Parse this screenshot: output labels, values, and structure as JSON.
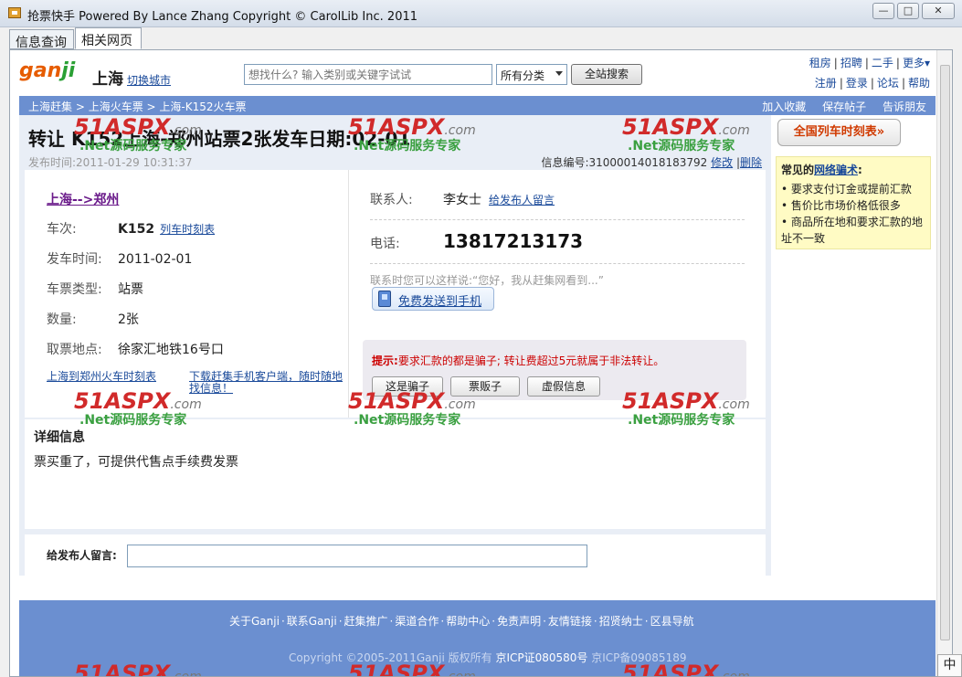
{
  "window": {
    "title": "抢票快手 Powered By Lance Zhang Copyright © CarolLib Inc. 2011",
    "minimize": "—",
    "maximize": "□",
    "close": "✕"
  },
  "tabs": [
    {
      "label": "信息查询"
    },
    {
      "label": "相关网页"
    }
  ],
  "header": {
    "logo_a": "gan",
    "logo_b": "ji",
    "city": "上海",
    "switch_city": "切换城市",
    "search_placeholder": "想找什么? 输入类别或关键字试试",
    "category": "所有分类",
    "search_button": "全站搜索",
    "links_top": [
      "租房",
      "招聘",
      "二手",
      "更多▾"
    ],
    "links_bottom": [
      "注册",
      "登录",
      "论坛",
      "帮助"
    ]
  },
  "breadcrumb": {
    "items": [
      "上海赶集",
      "> 上海火车票",
      "> 上海-K152火车票"
    ],
    "actions": [
      "加入收藏",
      "保存帖子",
      "告诉朋友"
    ]
  },
  "post": {
    "title": "转让 K152上海-郑州站票2张发车日期:02-01",
    "posted": "发布时间:2011-01-29 10:31:37",
    "info_no_label": "信息编号:",
    "info_no": "31000014018183792",
    "edit": "修改",
    "delete": "删除",
    "route": "上海-->郑州",
    "fields": [
      {
        "k": "车次:",
        "v": "K152",
        "link": "列车时刻表"
      },
      {
        "k": "发车时间:",
        "v": "2011-02-01"
      },
      {
        "k": "车票类型:",
        "v": "站票"
      },
      {
        "k": "数量:",
        "v": "2张"
      },
      {
        "k": "取票地点:",
        "v": "徐家汇地铁16号口"
      }
    ],
    "link_timetable": "上海到郑州火车时刻表",
    "link_client": "下载赶集手机客户端，随时随地找信息！"
  },
  "contact": {
    "label": "联系人:",
    "name": "李女士",
    "leave_msg": "给发布人留言",
    "phone_label": "电话:",
    "phone": "13817213173",
    "hint": "联系时您可以这样说:“您好，我从赶集网看到...”",
    "send_btn": "免费发送到手机",
    "warn_prefix": "提示:",
    "warn_text": "要求汇款的都是骗子; 转让费超过5元就属于非法转让。",
    "btn_scam": "这是骗子",
    "btn_scalper": "票贩子",
    "btn_fake": "虚假信息"
  },
  "detail": {
    "title": "详细信息",
    "text": "票买重了，可提供代售点手续费发票"
  },
  "message": {
    "label": "给发布人留言:"
  },
  "sidebar": {
    "train_btn": "全国列车时刻表»",
    "scam_title_a": "常见的",
    "scam_title_link": "网络骗术",
    "scam_title_b": ":",
    "scam_items": [
      "要求支付订金或提前汇款",
      "售价比市场价格低很多",
      "商品所在地和要求汇款的地址不一致"
    ]
  },
  "footer": {
    "links": [
      "关于Ganji",
      "联系Ganji",
      "赶集推广",
      "渠道合作",
      "帮助中心",
      "免责声明",
      "友情链接",
      "招贤纳士",
      "区县导航"
    ],
    "copyright_a": "Copyright ©2005-2011Ganji 版权所有",
    "copyright_b": "京ICP证080580号",
    "copyright_c": "京ICP备09085189"
  },
  "watermark": {
    "brand": "51ASPX",
    "suffix": ".com",
    "tagline": ".Net源码服务专家"
  },
  "ime": "中"
}
